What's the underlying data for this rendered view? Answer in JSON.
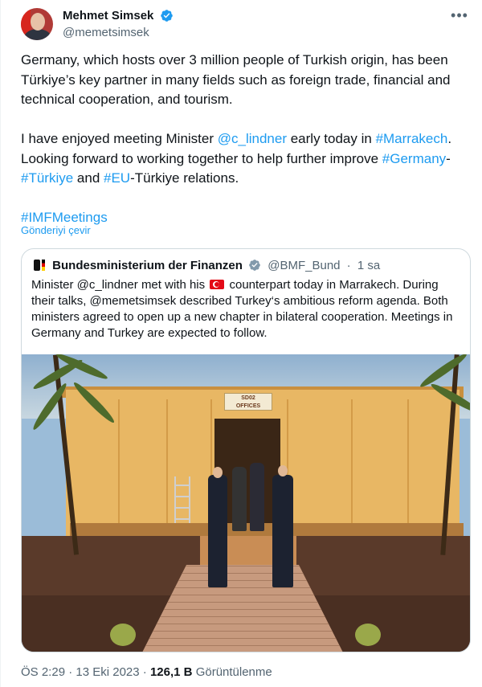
{
  "author": {
    "display_name": "Mehmet Simsek",
    "handle": "@memetsimsek",
    "verified_icon": "verified-badge-icon",
    "more_icon": "more-options-icon",
    "more_label": "•••"
  },
  "tweet": {
    "paragraph1": "Germany, which hosts over 3 million people of Turkish origin, has been Türkiye’s key partner in many fields such as foreign trade, financial and technical cooperation, and tourism.",
    "p2_text1": "I have enjoyed meeting Minister ",
    "p2_mention": "@c_lindner",
    "p2_text2": " early today in ",
    "p2_hashtag_marrakech": "#Marrakech",
    "p2_text3": ". Looking forward to working together to help further improve ",
    "p2_hashtag_germany": "#Germany",
    "p2_dash": "-",
    "p2_hashtag_turkiye": "#Türkiye",
    "p2_text4": " and ",
    "p2_hashtag_eu": "#EU",
    "p2_text5": "-Türkiye relations.",
    "hashtag_imf": "#IMFMeetings",
    "translate_label": "Gönderiyi çevir"
  },
  "quote": {
    "display_name": "Bundesministerium der Finanzen",
    "handle": "@BMF_Bund",
    "separator": "·",
    "time": "1 sa",
    "text_before_flag": "Minister @c_lindner met with his ",
    "flag_icon": "turkey-flag-icon",
    "text_after_flag": " counterpart today in Marrakech. During their talks, @memetsimsek described Turkey‘s ambitious reform agenda. Both ministers agreed to open up a new chapter in bilateral cooperation. Meetings in Germany and Turkey are expected to follow.",
    "photo": {
      "sign_line1": "SD02",
      "sign_line2": "OFFICES"
    }
  },
  "footer": {
    "time": "ÖS 2:29",
    "date": "13 Eki 2023",
    "dot": "·",
    "views_count": "126,1 B",
    "views_label": "Görüntülenme"
  },
  "colors": {
    "link": "#1d9bf0",
    "text": "#0f1419",
    "secondary": "#536471",
    "border": "#cfd9de"
  }
}
